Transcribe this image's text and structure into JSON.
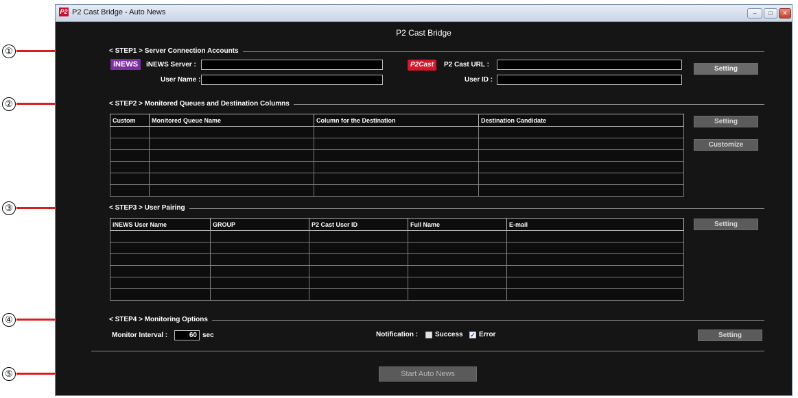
{
  "window": {
    "title": "P2 Cast Bridge - Auto News",
    "app_icon": "P2"
  },
  "app_title": "P2 Cast Bridge",
  "callouts": [
    "①",
    "②",
    "③",
    "④",
    "⑤"
  ],
  "step1": {
    "title": "< STEP1 > Server Connection Accounts",
    "inews_logo": "iNEWS",
    "inews_server_label": "iNEWS Server :",
    "user_name_label": "User Name :",
    "p2cast_logo": "P2Cast",
    "p2cast_url_label": "P2 Cast URL :",
    "user_id_label": "User ID :",
    "inews_server_value": "",
    "user_name_value": "",
    "p2cast_url_value": "",
    "user_id_value": "",
    "setting_label": "Setting"
  },
  "step2": {
    "title": "< STEP2 > Monitored Queues and Destination Columns",
    "columns": [
      "Custom",
      "Monitored Queue Name",
      "Column for the Destination",
      "Destination Candidate"
    ],
    "setting_label": "Setting",
    "customize_label": "Customize"
  },
  "step3": {
    "title": "< STEP3 > User Pairing",
    "columns": [
      "iNEWS User Name",
      "GROUP",
      "P2 Cast User ID",
      "Full Name",
      "E-mail"
    ],
    "setting_label": "Setting"
  },
  "step4": {
    "title": "< STEP4 > Monitoring Options",
    "monitor_interval_label": "Monitor Interval :",
    "monitor_interval_value": "60",
    "sec_label": "sec",
    "notification_label": "Notification :",
    "success_label": "Success",
    "success_checked": false,
    "error_label": "Error",
    "error_checked": true,
    "setting_label": "Setting"
  },
  "start_button_label": "Start Auto News",
  "colors": {
    "callout_line": "#d91e1e",
    "background": "#151515",
    "inews": "#7b2fa0",
    "p2cast": "#d4172b"
  }
}
